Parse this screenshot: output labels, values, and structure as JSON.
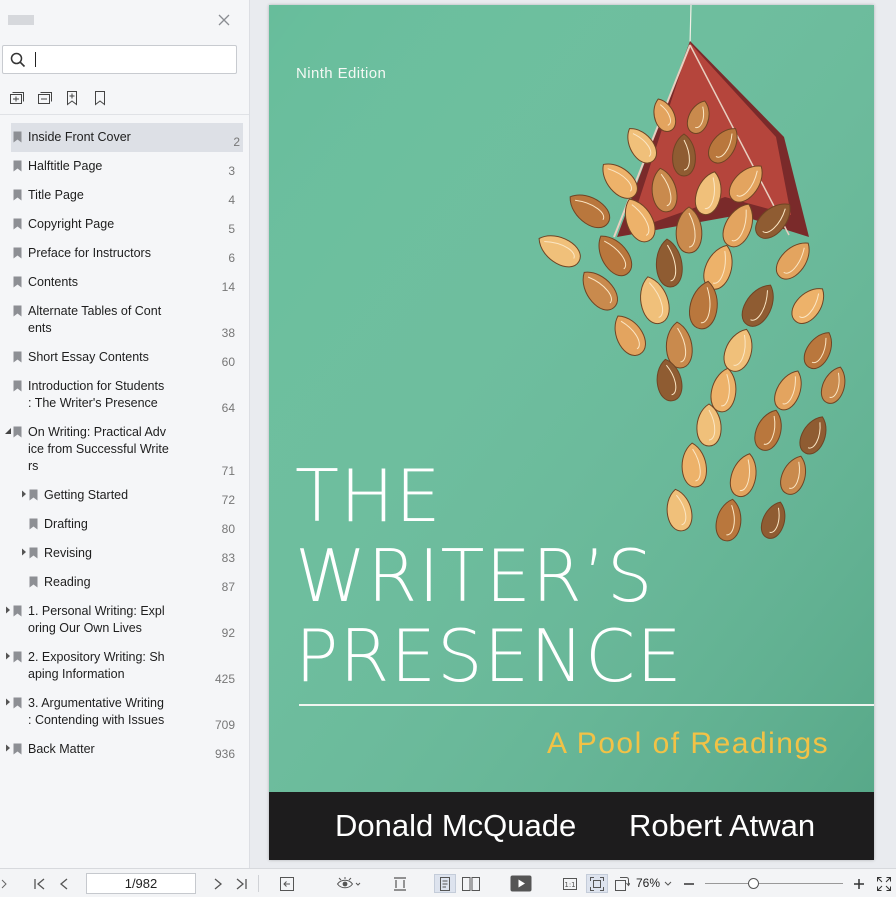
{
  "search": {
    "value": "",
    "placeholder": ""
  },
  "outline": [
    {
      "label": "Inside Front Cover",
      "page": "2",
      "expander": "none",
      "indent": 0,
      "selected": true
    },
    {
      "label": "Halftitle Page",
      "page": "3",
      "expander": "none",
      "indent": 0
    },
    {
      "label": "Title Page",
      "page": "4",
      "expander": "none",
      "indent": 0
    },
    {
      "label": "Copyright Page",
      "page": "5",
      "expander": "none",
      "indent": 0
    },
    {
      "label": "Preface for Instructors",
      "page": "6",
      "expander": "none",
      "indent": 0
    },
    {
      "label": "Contents",
      "page": "14",
      "expander": "none",
      "indent": 0
    },
    {
      "label": "Alternate Tables of Cont\nents",
      "page": "38",
      "expander": "none",
      "indent": 0
    },
    {
      "label": "Short Essay Contents",
      "page": "60",
      "expander": "none",
      "indent": 0
    },
    {
      "label": "Introduction for Students\n: The Writer's Presence",
      "page": "64",
      "expander": "none",
      "indent": 0
    },
    {
      "label": "On Writing: Practical Adv\nice from Successful Write\nrs",
      "page": "71",
      "expander": "expanded",
      "indent": 0
    },
    {
      "label": "Getting Started",
      "page": "72",
      "expander": "collapsed",
      "indent": 1
    },
    {
      "label": "Drafting",
      "page": "80",
      "expander": "none",
      "indent": 1
    },
    {
      "label": "Revising",
      "page": "83",
      "expander": "collapsed",
      "indent": 1
    },
    {
      "label": "Reading",
      "page": "87",
      "expander": "none",
      "indent": 1
    },
    {
      "label": "1. Personal Writing: Expl\noring Our Own Lives",
      "page": "92",
      "expander": "collapsed",
      "indent": 0
    },
    {
      "label": "2. Expository Writing: Sh\naping Information",
      "page": "425",
      "expander": "collapsed",
      "indent": 0
    },
    {
      "label": "3. Argumentative Writing\n: Contending with Issues",
      "page": "709",
      "expander": "collapsed",
      "indent": 0
    },
    {
      "label": "Back Matter",
      "page": "936",
      "expander": "collapsed",
      "indent": 0
    }
  ],
  "cover": {
    "edition": "Ninth Edition",
    "title_lines": [
      "THE",
      "WRITER’S",
      "PRESENCE"
    ],
    "subtitle": "A Pool of Readings",
    "authors": [
      "Donald McQuade",
      "Robert Atwan"
    ],
    "colors": {
      "background": "#67bd9b",
      "subtitle": "#f2c246",
      "author_bar": "#1d1c1d"
    }
  },
  "statusbar": {
    "page_indicator": "1/982",
    "zoom": "76%",
    "zoom_level": 0.35,
    "icons": [
      "first-page-icon",
      "prev-page-icon",
      "next-page-icon",
      "last-page-icon",
      "back-icon",
      "eye-icon",
      "fit-width-icon",
      "single-page-icon",
      "two-page-icon",
      "play-icon",
      "actual-size-icon",
      "fit-page-icon",
      "rotate-icon",
      "zoom-out-icon",
      "zoom-in-icon",
      "fullscreen-icon"
    ]
  }
}
